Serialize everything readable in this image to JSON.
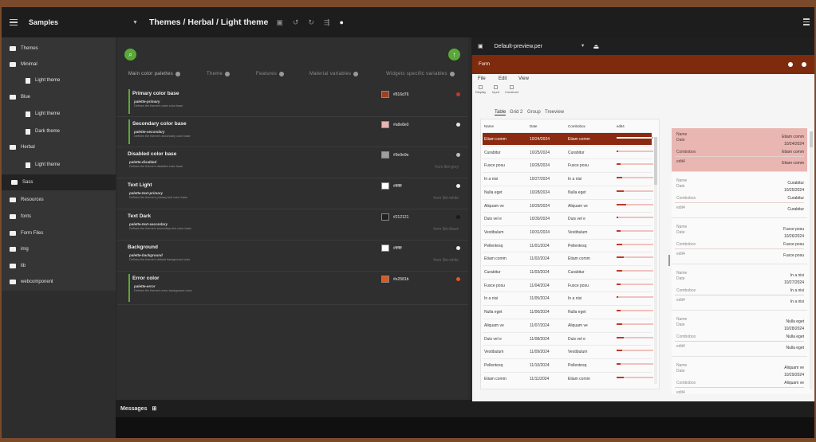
{
  "header": {
    "project": "Samples",
    "breadcrumb": "Themes / Herbal / Light theme"
  },
  "sidebar": {
    "items": [
      {
        "label": "Themes"
      },
      {
        "label": "Minimal"
      },
      {
        "label": "Light theme"
      },
      {
        "label": "Blue"
      },
      {
        "label": "Light theme"
      },
      {
        "label": "Dark theme"
      },
      {
        "label": "Herbal"
      },
      {
        "label": "Light theme"
      },
      {
        "label": "Sass"
      },
      {
        "label": "Resources"
      },
      {
        "label": "fonts"
      },
      {
        "label": "Form Files"
      },
      {
        "label": "img"
      },
      {
        "label": "lib"
      },
      {
        "label": "webcomponent"
      }
    ]
  },
  "editor": {
    "tabs": [
      "Main color palettes",
      "Theme",
      "Features",
      "Material variables",
      "Widgets specific variables"
    ],
    "palettes": [
      {
        "title": "Primary color base",
        "var": "palette-primary",
        "desc": "Defines the theme's main color base",
        "hex": "#816d76",
        "from": "",
        "color": "#a0401e",
        "dot": "#c0392b"
      },
      {
        "title": "Secondary color base",
        "var": "palette-secondary",
        "desc": "Defines the theme's secondary color base",
        "hex": "#a8e8e0",
        "from": "",
        "color": "#e8b4b4",
        "dot": "#e6e6e6"
      },
      {
        "title": "Disabled color base",
        "var": "palette-disabled",
        "desc": "Defines the theme's disabled color base",
        "hex": "#9e9e9e",
        "from": "from $nt-grey",
        "color": "#9e9e9e",
        "dot": "#bdbdbd"
      },
      {
        "title": "Text Light",
        "var": "palette-text-primary",
        "desc": "Defines the theme's primary text color base",
        "hex": "#ffffff",
        "from": "from $nt-white",
        "color": "#ffffff",
        "dot": "#eeeeee"
      },
      {
        "title": "Text Dark",
        "var": "palette-text-secondary",
        "desc": "Defines the theme's secondary text color base",
        "hex": "#212121",
        "from": "from $nt-black",
        "color": "#212121",
        "dot": "#1a1a1a"
      },
      {
        "title": "Background",
        "var": "palette-background",
        "desc": "Defines the theme's default background color",
        "hex": "#ffffff",
        "from": "from $nt-white",
        "color": "#ffffff",
        "dot": "#eeeeee"
      },
      {
        "title": "Error color",
        "var": "palette-error",
        "desc": "Defines the theme's error background color",
        "hex": "#e2581b",
        "from": "",
        "color": "#e2581b",
        "dot": "#e2581b"
      }
    ]
  },
  "messages": {
    "label": "Messages"
  },
  "preview": {
    "file": "Default-preview.per",
    "form_title": "Form",
    "menu": [
      "File",
      "Edit",
      "View"
    ],
    "toolbar": [
      "Display",
      "Input",
      "Construct"
    ],
    "tabs": [
      "Table",
      "Grid 2",
      "Group",
      "Treeview"
    ],
    "columns": [
      "Name",
      "Date",
      "Combobox",
      "edit4"
    ],
    "rows": [
      {
        "name": "Etiam comm",
        "date": "10/24/2024",
        "combo": "Etiam comm",
        "fill": 0.95
      },
      {
        "name": "Curabitur",
        "date": "10/25/2024",
        "combo": "Curabitur",
        "fill": 0.05
      },
      {
        "name": "Fusce posu",
        "date": "10/26/2024",
        "combo": "Fusce posu",
        "fill": 0.1
      },
      {
        "name": "In a nisi",
        "date": "10/27/2024",
        "combo": "In a nisi",
        "fill": 0.15
      },
      {
        "name": "Nulla eget",
        "date": "10/28/2024",
        "combo": "Nulla eget",
        "fill": 0.2
      },
      {
        "name": "Aliquam ve",
        "date": "10/29/2024",
        "combo": "Aliquam ve",
        "fill": 0.25
      },
      {
        "name": "Duis vel e",
        "date": "10/30/2024",
        "combo": "Duis vel e",
        "fill": 0.05
      },
      {
        "name": "Vestibulum",
        "date": "10/31/2024",
        "combo": "Vestibulum",
        "fill": 0.1
      },
      {
        "name": "Pellentesq",
        "date": "11/01/2024",
        "combo": "Pellentesq",
        "fill": 0.15
      },
      {
        "name": "Etiam comm",
        "date": "11/02/2024",
        "combo": "Etiam comm",
        "fill": 0.2
      },
      {
        "name": "Curabitur",
        "date": "11/03/2024",
        "combo": "Curabitur",
        "fill": 0.15
      },
      {
        "name": "Fusce posu",
        "date": "11/04/2024",
        "combo": "Fusce posu",
        "fill": 0.1
      },
      {
        "name": "In a nisi",
        "date": "11/05/2024",
        "combo": "In a nisi",
        "fill": 0.05
      },
      {
        "name": "Nulla eget",
        "date": "11/06/2024",
        "combo": "Nulla eget",
        "fill": 0.1
      },
      {
        "name": "Aliquam ve",
        "date": "11/07/2024",
        "combo": "Aliquam ve",
        "fill": 0.15
      },
      {
        "name": "Duis vel e",
        "date": "11/08/2024",
        "combo": "Duis vel e",
        "fill": 0.2
      },
      {
        "name": "Vestibulum",
        "date": "11/09/2024",
        "combo": "Vestibulum",
        "fill": 0.15
      },
      {
        "name": "Pellentesq",
        "date": "11/10/2024",
        "combo": "Pellentesq",
        "fill": 0.1
      },
      {
        "name": "Etiam comm",
        "date": "11/11/2024",
        "combo": "Etiam comm",
        "fill": 0.2
      }
    ],
    "card_labels": {
      "name": "Name",
      "date": "Date",
      "combo": "Combobox",
      "edit": "edit4"
    },
    "cards": [
      {
        "name": "Etiam comm",
        "date": "10/24/2024",
        "combo": "Etiam comm",
        "edit": "Etiam comm"
      },
      {
        "name": "Curabitur",
        "date": "10/25/2024",
        "combo": "Curabitur",
        "edit": "Curabitur"
      },
      {
        "name": "Fusce posu",
        "date": "10/26/2024",
        "combo": "Fusce posu",
        "edit": "Fusce posu"
      },
      {
        "name": "In a nisi",
        "date": "10/27/2024",
        "combo": "In a nisi",
        "edit": "In a nisi"
      },
      {
        "name": "Nulla eget",
        "date": "10/28/2024",
        "combo": "Nulla eget",
        "edit": "Nulla eget"
      },
      {
        "name": "Aliquam ve",
        "date": "10/29/2024",
        "combo": "Aliquam ve",
        "edit": ""
      }
    ]
  },
  "colors": {
    "accent": "#5aa83a",
    "form_header": "#7e2a0c",
    "selected_row": "#8b2a10",
    "selected_card": "#eab6b2"
  }
}
